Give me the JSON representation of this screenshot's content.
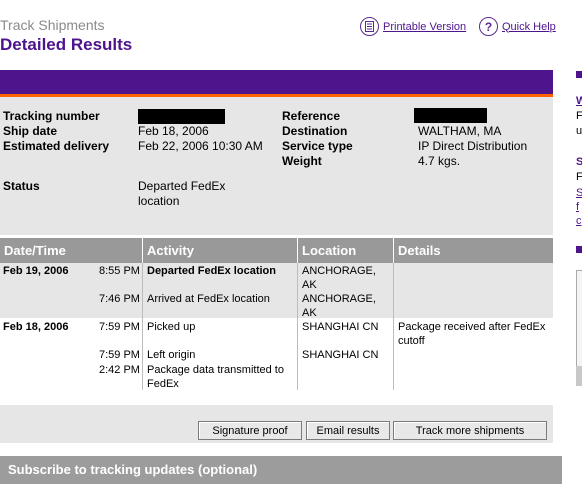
{
  "header": {
    "subtitle": "Track Shipments",
    "title": "Detailed Results",
    "printable_label": "Printable Version",
    "quickhelp_label": "Quick Help"
  },
  "summary": {
    "tracking_label": "Tracking number",
    "ship_date_label": "Ship date",
    "ship_date": "Feb 18, 2006",
    "est_delivery_label": "Estimated delivery",
    "est_delivery": "Feb 22, 2006 10:30 AM",
    "reference_label": "Reference",
    "destination_label": "Destination",
    "destination": "WALTHAM, MA",
    "service_label": "Service type",
    "service": "IP Direct Distribution",
    "weight_label": "Weight",
    "weight": "4.7 kgs.",
    "status_label": "Status",
    "status_line1": "Departed FedEx",
    "status_line2": "location"
  },
  "table": {
    "headers": [
      "Date/Time",
      "Activity",
      "Location",
      "Details"
    ],
    "rows": [
      {
        "date": "Feb 19, 2006",
        "time": "8:55 PM",
        "activity": "Departed FedEx location",
        "loc1": "ANCHORAGE,",
        "loc2": "AK",
        "details1": "",
        "details2": ""
      },
      {
        "date": "",
        "time": "7:46 PM",
        "activity": "Arrived at FedEx location",
        "loc1": "ANCHORAGE,",
        "loc2": "AK",
        "details1": "",
        "details2": ""
      },
      {
        "date": "Feb 18, 2006",
        "time": "7:59 PM",
        "activity": "Picked up",
        "loc1": "SHANGHAI CN",
        "loc2": "",
        "details1": "Package received after FedEx",
        "details2": "cutoff"
      },
      {
        "date": "",
        "time": "7:59 PM",
        "activity": "Left origin",
        "loc1": "SHANGHAI CN",
        "loc2": "",
        "details1": "",
        "details2": ""
      },
      {
        "date": "",
        "time": "2:42 PM",
        "activity": "Package data transmitted to",
        "activity2": "FedEx",
        "loc1": "",
        "loc2": "",
        "details1": "",
        "details2": ""
      }
    ]
  },
  "buttons": {
    "signature": "Signature proof",
    "email": "Email results",
    "track_more": "Track more shipments"
  },
  "subscribe": "Subscribe to tracking updates (optional)",
  "right_edge": {
    "l1": "W",
    "l2": "F",
    "l3": "u",
    "l4": "S",
    "l5": "F",
    "l6": "S",
    "l7": "f",
    "l8": "c"
  },
  "colors": {
    "brand_purple": "#4d148c",
    "brand_orange": "#ff6200",
    "header_gray": "#999999",
    "panel_gray": "#e6e6e6"
  }
}
